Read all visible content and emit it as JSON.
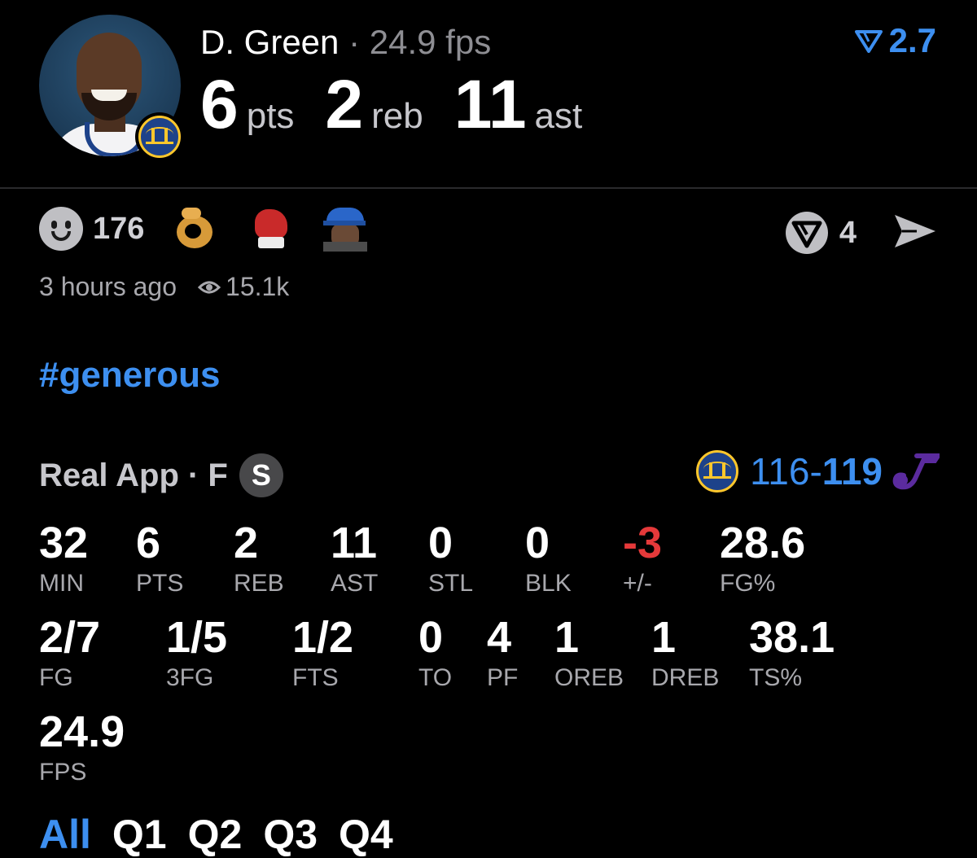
{
  "player": {
    "name": "D. Green",
    "separator": "·",
    "fps_summary": "24.9 fps",
    "rating": "2.7",
    "headline": [
      {
        "value": "6",
        "unit": "pts"
      },
      {
        "value": "2",
        "unit": "reb"
      },
      {
        "value": "11",
        "unit": "ast"
      }
    ]
  },
  "reactions": {
    "count": "176",
    "emojis": [
      "ok-hand-icon",
      "boxing-glove-icon",
      "fan-face-icon"
    ],
    "comments_count": "4"
  },
  "meta": {
    "time_ago": "3 hours ago",
    "views": "15.1k"
  },
  "hashtag": "#generous",
  "box": {
    "source": "Real App · F",
    "badge": "S",
    "score_home": "116",
    "score_dash": "-",
    "score_away": "119",
    "row1": [
      {
        "value": "32",
        "label": "MIN"
      },
      {
        "value": "6",
        "label": "PTS"
      },
      {
        "value": "2",
        "label": "REB"
      },
      {
        "value": "11",
        "label": "AST"
      },
      {
        "value": "0",
        "label": "STL"
      },
      {
        "value": "0",
        "label": "BLK"
      },
      {
        "value": "-3",
        "label": "+/-"
      },
      {
        "value": "28.6",
        "label": "FG%"
      }
    ],
    "row2": [
      {
        "value": "2/7",
        "label": "FG"
      },
      {
        "value": "1/5",
        "label": "3FG"
      },
      {
        "value": "1/2",
        "label": "FTS"
      },
      {
        "value": "0",
        "label": "TO"
      },
      {
        "value": "4",
        "label": "PF"
      },
      {
        "value": "1",
        "label": "OREB"
      },
      {
        "value": "1",
        "label": "DREB"
      },
      {
        "value": "38.1",
        "label": "TS%"
      }
    ],
    "row3": [
      {
        "value": "24.9",
        "label": "FPS"
      }
    ]
  },
  "tabs": [
    "All",
    "Q1",
    "Q2",
    "Q3",
    "Q4"
  ],
  "colors": {
    "accent": "#3d8ff0",
    "negative": "#e5393a",
    "warriors_blue": "#1d428a",
    "warriors_gold": "#ffc72c",
    "jazz_purple": "#5b2b9e"
  }
}
